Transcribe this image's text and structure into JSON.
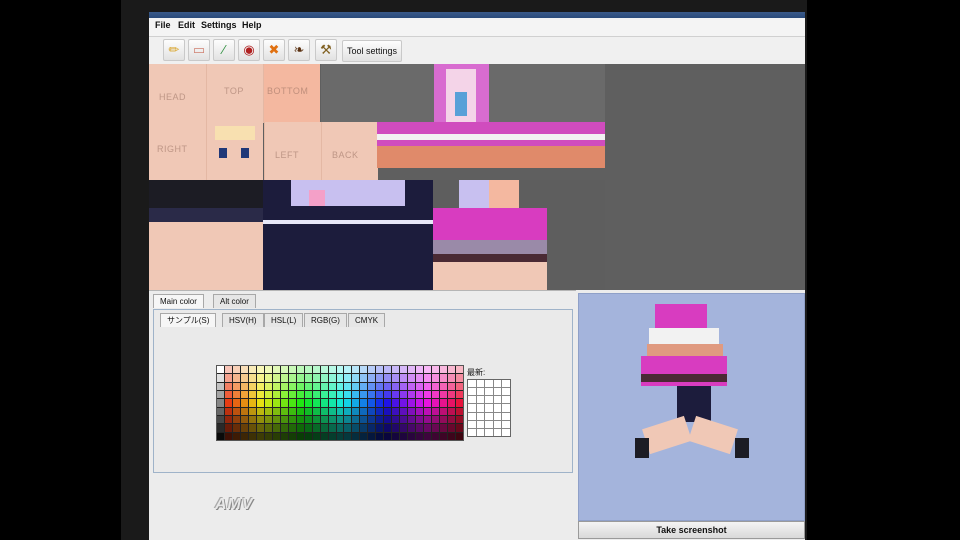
{
  "menu": {
    "items": [
      "File",
      "Edit",
      "Settings",
      "Help"
    ]
  },
  "toolbar": {
    "tools": [
      {
        "name": "pencil-icon",
        "glyph": "✏"
      },
      {
        "name": "eraser-icon",
        "glyph": "▭"
      },
      {
        "name": "eyedropper-icon",
        "glyph": "⁄"
      },
      {
        "name": "bucket-icon",
        "glyph": "◉"
      },
      {
        "name": "crossed-tools-icon",
        "glyph": "✖"
      },
      {
        "name": "brush-icon",
        "glyph": "❧"
      },
      {
        "name": "hammer-wrench-icon",
        "glyph": "⚒"
      }
    ],
    "settings_label": "Tool settings"
  },
  "skin_labels": {
    "head": "HEAD",
    "top": "TOP",
    "bottom": "BOTTOM",
    "right": "RIGHT",
    "left": "LEFT",
    "back": "BACK"
  },
  "color_panel": {
    "tabs": [
      "Main color",
      "Alt color"
    ],
    "subtabs": [
      "サンプル(S)",
      "HSV(H)",
      "HSL(L)",
      "RGB(G)",
      "CMYK"
    ],
    "recent_label": "最新:"
  },
  "logo_text": "AMV",
  "preview": {
    "screenshot_label": "Take screenshot"
  },
  "colors": {
    "skin": "#f0c8b6",
    "magenta": "#d83cc0",
    "lavender": "#c8c0f0",
    "navy": "#1c1c3c",
    "preview_bg": "#a4b4dc"
  }
}
